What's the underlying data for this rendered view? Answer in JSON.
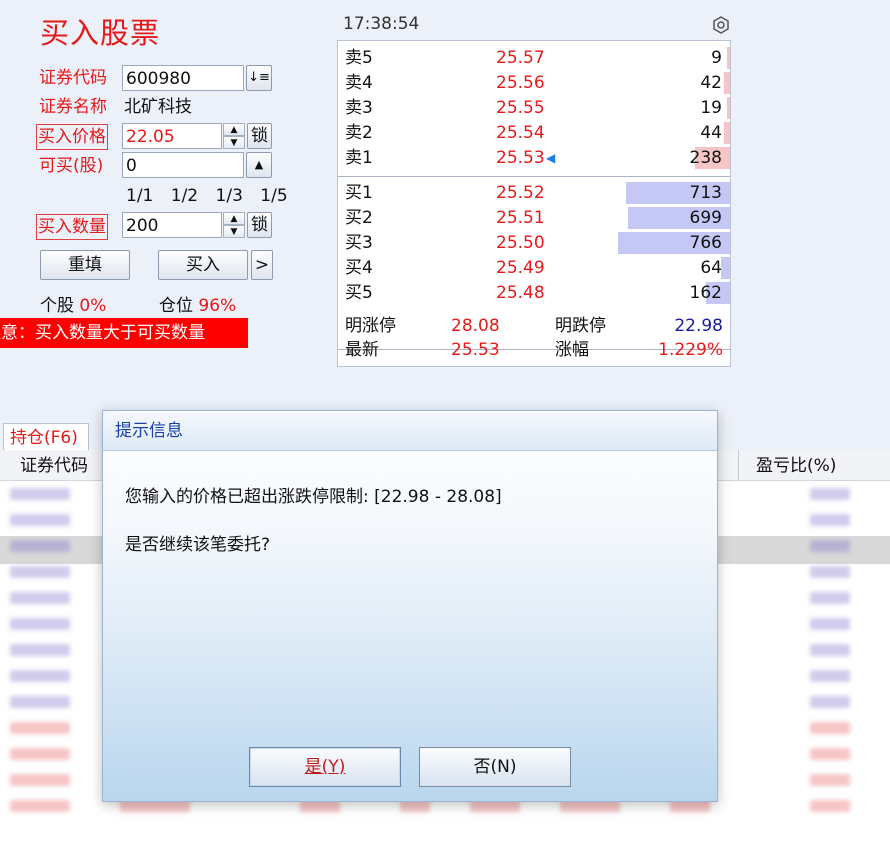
{
  "title": "买入股票",
  "form": {
    "code_label": "证券代码",
    "code_value": "600980",
    "sort_icon": "↓≡",
    "name_label": "证券名称",
    "name_value": "北矿科技",
    "price_label": "买入价格",
    "price_value": "22.05",
    "lock_label": "锁",
    "maxbuy_label": "可买(股)",
    "maxbuy_value": "0",
    "fractions": [
      "1/1",
      "1/2",
      "1/3",
      "1/5"
    ],
    "qty_label": "买入数量",
    "qty_value": "200",
    "reset_label": "重填",
    "buy_label": "买入",
    "more_label": ">",
    "stock_pos_label": "个股",
    "stock_pos_value": "0%",
    "total_pos_label": "仓位",
    "total_pos_value": "96%",
    "warning": "注意：买入数量大于可买数量"
  },
  "quote": {
    "time": "17:38:54",
    "settings_icon": "gear-icon",
    "asks": [
      {
        "name": "卖5",
        "price": "25.57",
        "vol": "9",
        "bar": 0.012
      },
      {
        "name": "卖4",
        "price": "25.56",
        "vol": "42",
        "bar": 0.055
      },
      {
        "name": "卖3",
        "price": "25.55",
        "vol": "19",
        "bar": 0.025
      },
      {
        "name": "卖2",
        "price": "25.54",
        "vol": "44",
        "bar": 0.058
      },
      {
        "name": "卖1",
        "price": "25.53",
        "vol": "238",
        "bar": 0.31
      }
    ],
    "bids": [
      {
        "name": "买1",
        "price": "25.52",
        "vol": "713",
        "bar": 0.93
      },
      {
        "name": "买2",
        "price": "25.51",
        "vol": "699",
        "bar": 0.91
      },
      {
        "name": "买3",
        "price": "25.50",
        "vol": "766",
        "bar": 1.0
      },
      {
        "name": "买4",
        "price": "25.49",
        "vol": "64",
        "bar": 0.084
      },
      {
        "name": "买5",
        "price": "25.48",
        "vol": "162",
        "bar": 0.21
      }
    ],
    "limit_up_label": "明涨停",
    "limit_up_value": "28.08",
    "limit_down_label": "明跌停",
    "limit_down_value": "22.98",
    "last_label": "最新",
    "last_value": "25.53",
    "change_label": "涨幅",
    "change_value": "1.229%",
    "colors": {
      "ask_bar": "#f6c6c6",
      "bid_bar": "#c5c8f4",
      "down": "#1a1a9e",
      "up": "#e61919"
    }
  },
  "tabs": {
    "holdings": "持仓(F6)"
  },
  "table": {
    "col_code": "证券代码",
    "col_pnl": "盈亏比(%)"
  },
  "dialog": {
    "title": "提示信息",
    "message": "您输入的价格已超出涨跌停限制: [22.98 - 28.08]",
    "question": "是否继续该笔委托?",
    "yes_label": "是(Y)",
    "no_label": "否(N)"
  }
}
